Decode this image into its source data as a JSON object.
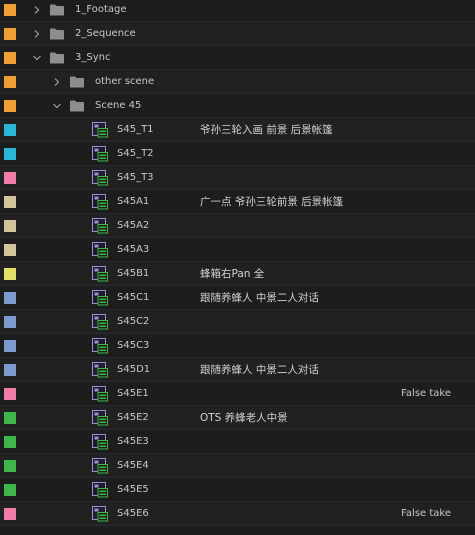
{
  "project_panel": {
    "rows": [
      {
        "type": "folder",
        "depth": 0,
        "expanded": false,
        "name": "1_Footage",
        "color": "#f0a033",
        "desc": "",
        "note": ""
      },
      {
        "type": "folder",
        "depth": 0,
        "expanded": false,
        "name": "2_Sequence",
        "color": "#f0a033",
        "desc": "",
        "note": ""
      },
      {
        "type": "folder",
        "depth": 0,
        "expanded": true,
        "name": "3_Sync",
        "color": "#f0a033",
        "desc": "",
        "note": ""
      },
      {
        "type": "folder",
        "depth": 1,
        "expanded": false,
        "name": "other scene",
        "color": "#f0a033",
        "desc": "",
        "note": ""
      },
      {
        "type": "folder",
        "depth": 1,
        "expanded": true,
        "name": "Scene 45",
        "color": "#f0a033",
        "desc": "",
        "note": ""
      },
      {
        "type": "sequence",
        "name": "S45_T1",
        "color": "#2ab7d6",
        "desc": "爷孙三轮入画 前景 后景帐篷",
        "note": ""
      },
      {
        "type": "sequence",
        "name": "S45_T2",
        "color": "#2ab7d6",
        "desc": "",
        "note": ""
      },
      {
        "type": "sequence",
        "name": "S45_T3",
        "color": "#f07ca8",
        "desc": "",
        "note": ""
      },
      {
        "type": "sequence",
        "name": "S45A1",
        "color": "#d2c49b",
        "desc": "广一点 爷孙三轮前景 后景帐篷",
        "note": ""
      },
      {
        "type": "sequence",
        "name": "S45A2",
        "color": "#d2c49b",
        "desc": "",
        "note": ""
      },
      {
        "type": "sequence",
        "name": "S45A3",
        "color": "#d2c49b",
        "desc": "",
        "note": ""
      },
      {
        "type": "sequence",
        "name": "S45B1",
        "color": "#e2e066",
        "desc": "蜂箱右Pan 全",
        "note": ""
      },
      {
        "type": "sequence",
        "name": "S45C1",
        "color": "#7d9ccd",
        "desc": "跟随养蜂人 中景二人对话",
        "note": ""
      },
      {
        "type": "sequence",
        "name": "S45C2",
        "color": "#7d9ccd",
        "desc": "",
        "note": ""
      },
      {
        "type": "sequence",
        "name": "S45C3",
        "color": "#7d9ccd",
        "desc": "",
        "note": ""
      },
      {
        "type": "sequence",
        "name": "S45D1",
        "color": "#7d9ccd",
        "desc": "跟随养蜂人 中景二人对话",
        "note": ""
      },
      {
        "type": "sequence",
        "name": "S45E1",
        "color": "#f07ca8",
        "desc": "",
        "note": "False take"
      },
      {
        "type": "sequence",
        "name": "S45E2",
        "color": "#3fb64a",
        "desc": "OTS 养蜂老人中景",
        "note": ""
      },
      {
        "type": "sequence",
        "name": "S45E3",
        "color": "#3fb64a",
        "desc": "",
        "note": ""
      },
      {
        "type": "sequence",
        "name": "S45E4",
        "color": "#3fb64a",
        "desc": "",
        "note": ""
      },
      {
        "type": "sequence",
        "name": "S45E5",
        "color": "#3fb64a",
        "desc": "",
        "note": ""
      },
      {
        "type": "sequence",
        "name": "S45E6",
        "color": "#f07ca8",
        "desc": "",
        "note": "False take"
      }
    ]
  },
  "icons": {
    "folder": "folder-icon",
    "chevron_collapsed": "chevron-right-icon",
    "chevron_expanded": "chevron-down-icon",
    "sequence": "sequence-icon"
  },
  "colors": {
    "folder_icon": "#8e8e8e",
    "sequence_frame": "#9b8fe0",
    "sequence_clip": "#3fb64a"
  }
}
